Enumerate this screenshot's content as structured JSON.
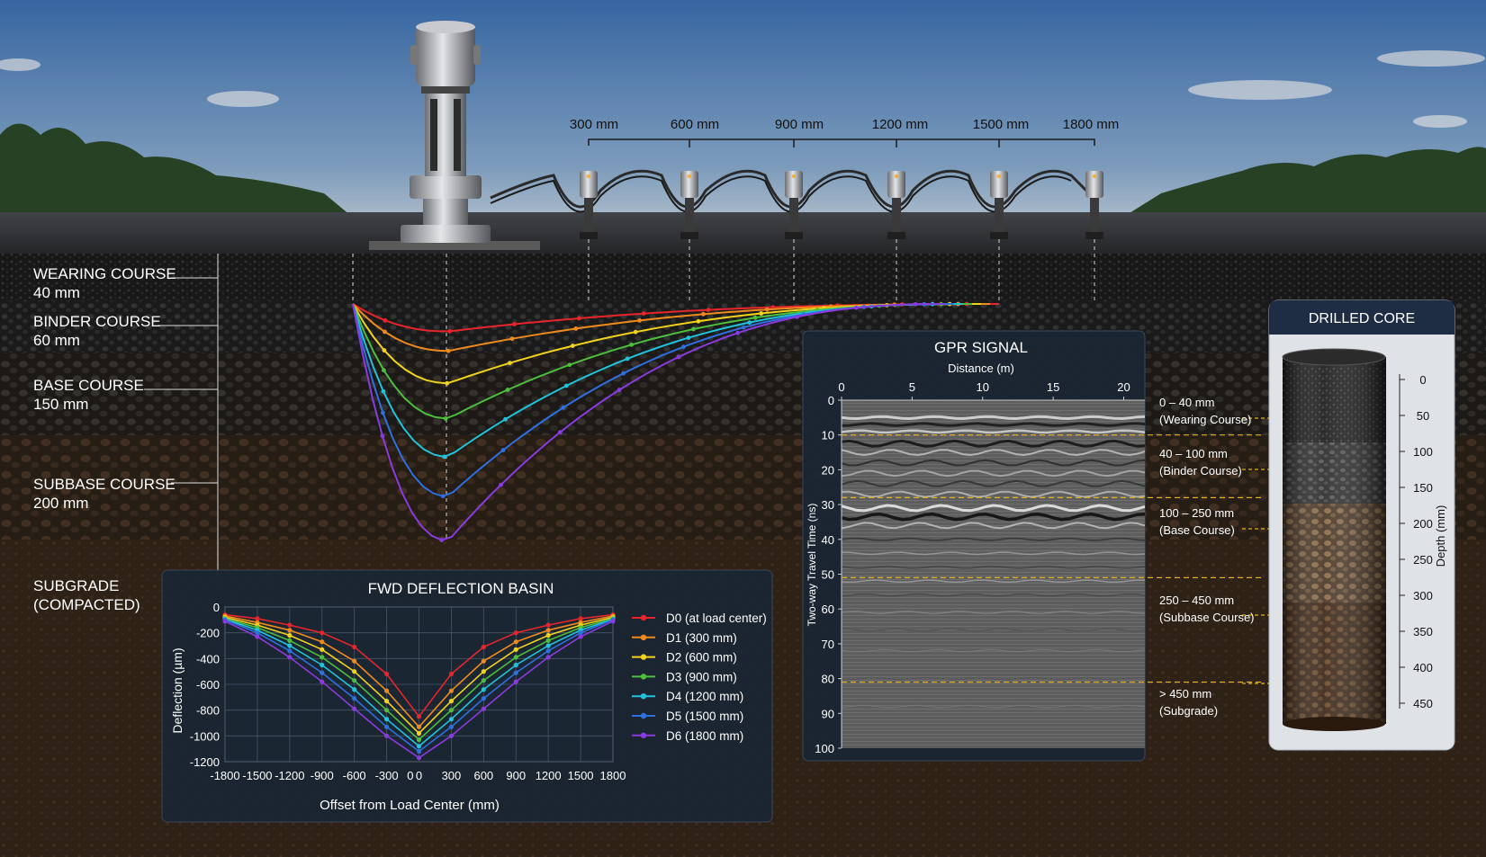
{
  "sensor_spacing_labels": [
    "300 mm",
    "600 mm",
    "900 mm",
    "1200 mm",
    "1500 mm",
    "1800 mm"
  ],
  "layers": [
    {
      "name": "WEARING COURSE",
      "thickness": "40 mm"
    },
    {
      "name": "BINDER COURSE",
      "thickness": "60 mm"
    },
    {
      "name": "BASE COURSE",
      "thickness": "150 mm"
    },
    {
      "name": "SUBBASE COURSE",
      "thickness": "200 mm"
    },
    {
      "name": "SUBGRADE",
      "thickness": "(COMPACTED)"
    }
  ],
  "colors": {
    "series": [
      "#e8252a",
      "#f08a1c",
      "#f2d21b",
      "#4cbf3c",
      "#1fc4dc",
      "#2f6fe0",
      "#8a3be0"
    ],
    "sky_top": "#3f74b8",
    "sky_bottom": "#c9d9e8",
    "asphalt": "#1f1f1f",
    "panel_bg": "#1b2633",
    "core_header": "#1e2d44",
    "guide_line": "#e2b21c"
  },
  "fwd_chart": {
    "title": "FWD DEFLECTION BASIN",
    "xlabel": "Offset from Load Center (mm)",
    "ylabel": "Deflection (µm)",
    "x_ticks": [
      "-1800",
      "-1500",
      "-1200",
      "-900",
      "-600",
      "-300",
      "0",
      "0",
      "300",
      "600",
      "900",
      "1200",
      "1500",
      "1800"
    ],
    "y_ticks": [
      "0",
      "-200",
      "-400",
      "-600",
      "-800",
      "-1000",
      "-1200"
    ],
    "legend": [
      "D0 (at load center)",
      "D1 (300 mm)",
      "D2 (600 mm)",
      "D3 (900 mm)",
      "D4 (1200 mm)",
      "D5 (1500 mm)",
      "D6 (1800 mm)"
    ]
  },
  "gpr": {
    "title": "GPR SIGNAL",
    "xlabel": "Distance (m)",
    "ylabel": "Two-way Travel Time (ns)",
    "x_ticks": [
      "0",
      "5",
      "10",
      "15",
      "20"
    ],
    "y_ticks": [
      "0",
      "10",
      "20",
      "30",
      "40",
      "50",
      "60",
      "70",
      "80",
      "90",
      "100"
    ],
    "interfaces_ns": [
      10,
      28,
      51,
      81
    ],
    "annotations": [
      {
        "range": "0 – 40 mm",
        "layer": "(Wearing Course)"
      },
      {
        "range": "40 – 100 mm",
        "layer": "(Binder Course)"
      },
      {
        "range": "100 – 250 mm",
        "layer": "(Base Course)"
      },
      {
        "range": "250 – 450 mm",
        "layer": "(Subbase Course)"
      },
      {
        "range": "> 450 mm",
        "layer": "(Subgrade)"
      }
    ]
  },
  "core": {
    "title": "DRILLED CORE",
    "axis_label": "Depth (mm)",
    "ticks": [
      "0",
      "50",
      "100",
      "150",
      "200",
      "250",
      "300",
      "350",
      "400",
      "450"
    ]
  },
  "chart_data": {
    "type": "line",
    "title": "FWD DEFLECTION BASIN",
    "xlabel": "Offset from Load Center (mm)",
    "ylabel": "Deflection (µm)",
    "xlim": [
      -1800,
      1800
    ],
    "ylim": [
      -1200,
      0
    ],
    "x": [
      -1800,
      -1500,
      -1200,
      -900,
      -600,
      -300,
      0,
      300,
      600,
      900,
      1200,
      1500,
      1800
    ],
    "series": [
      {
        "name": "D0 (at load center)",
        "values": [
          -60,
          -90,
          -140,
          -200,
          -310,
          -520,
          -850,
          -520,
          -310,
          -200,
          -140,
          -90,
          -60
        ]
      },
      {
        "name": "D1 (300 mm)",
        "values": [
          -70,
          -120,
          -180,
          -270,
          -420,
          -650,
          -930,
          -650,
          -420,
          -270,
          -180,
          -120,
          -70
        ]
      },
      {
        "name": "D2 (600 mm)",
        "values": [
          -80,
          -140,
          -220,
          -330,
          -500,
          -730,
          -980,
          -730,
          -500,
          -330,
          -220,
          -140,
          -80
        ]
      },
      {
        "name": "D3 (900 mm)",
        "values": [
          -90,
          -160,
          -260,
          -390,
          -570,
          -800,
          -1030,
          -800,
          -570,
          -390,
          -260,
          -160,
          -90
        ]
      },
      {
        "name": "D4 (1200 mm)",
        "values": [
          -95,
          -180,
          -300,
          -450,
          -640,
          -870,
          -1080,
          -870,
          -640,
          -450,
          -300,
          -180,
          -95
        ]
      },
      {
        "name": "D5 (1500 mm)",
        "values": [
          -100,
          -200,
          -340,
          -510,
          -710,
          -930,
          -1120,
          -930,
          -710,
          -510,
          -340,
          -200,
          -100
        ]
      },
      {
        "name": "D6 (1800 mm)",
        "values": [
          -110,
          -230,
          -390,
          -580,
          -790,
          -1000,
          -1170,
          -1000,
          -790,
          -580,
          -390,
          -230,
          -110
        ]
      }
    ]
  }
}
